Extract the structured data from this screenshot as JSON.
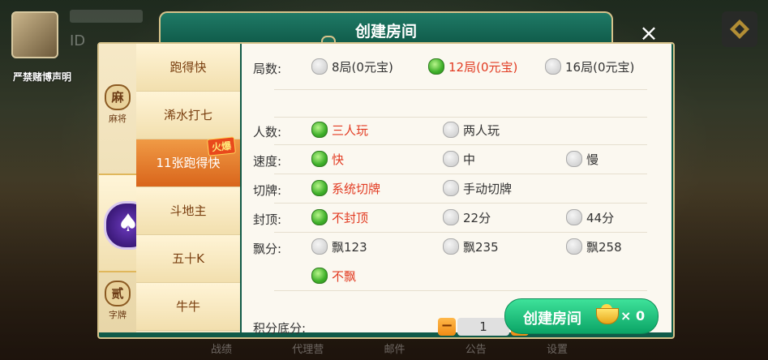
{
  "background": {
    "player_id_text": "ID",
    "warning_text": "严禁赌博声明",
    "bottom_nav": [
      "战绩",
      "代理营",
      "邮件",
      "公告",
      "设置"
    ]
  },
  "dialog": {
    "title": "创建房间",
    "close_label": "×"
  },
  "sidebar": {
    "items": [
      {
        "icon": "麻",
        "label": "麻将"
      },
      {
        "icon": "♠",
        "label": ""
      },
      {
        "icon": "贰",
        "label": "字牌"
      }
    ]
  },
  "games": {
    "items": [
      "跑得快",
      "浠水打七",
      "11张跑得快",
      "斗地主",
      "五十K",
      "牛牛"
    ],
    "active_index": 2,
    "hot_badge": "火爆"
  },
  "options": {
    "rounds": {
      "label": "局数:",
      "choices": [
        "8局(0元宝)",
        "12局(0元宝)",
        "16局(0元宝)"
      ],
      "selected": 1
    },
    "players": {
      "label": "人数:",
      "choices": [
        "三人玩",
        "两人玩"
      ],
      "selected": 0
    },
    "speed": {
      "label": "速度:",
      "choices": [
        "快",
        "中",
        "慢"
      ],
      "selected": 0
    },
    "cut": {
      "label": "切牌:",
      "choices": [
        "系统切牌",
        "手动切牌"
      ],
      "selected": 0
    },
    "cap": {
      "label": "封顶:",
      "choices": [
        "不封顶",
        "22分",
        "44分"
      ],
      "selected": 0
    },
    "float": {
      "label": "飘分:",
      "choices": [
        "飘123",
        "飘235",
        "飘258",
        "不飘"
      ],
      "selected": 3
    }
  },
  "score": {
    "label": "积分底分:",
    "minus": "−",
    "plus": "+",
    "value": "1"
  },
  "create_button": {
    "label": "创建房间",
    "count": "× 0"
  },
  "colors": {
    "accent_green": "#0ba466",
    "selected_text": "#e23b22",
    "active_tab": "#d9651b"
  }
}
